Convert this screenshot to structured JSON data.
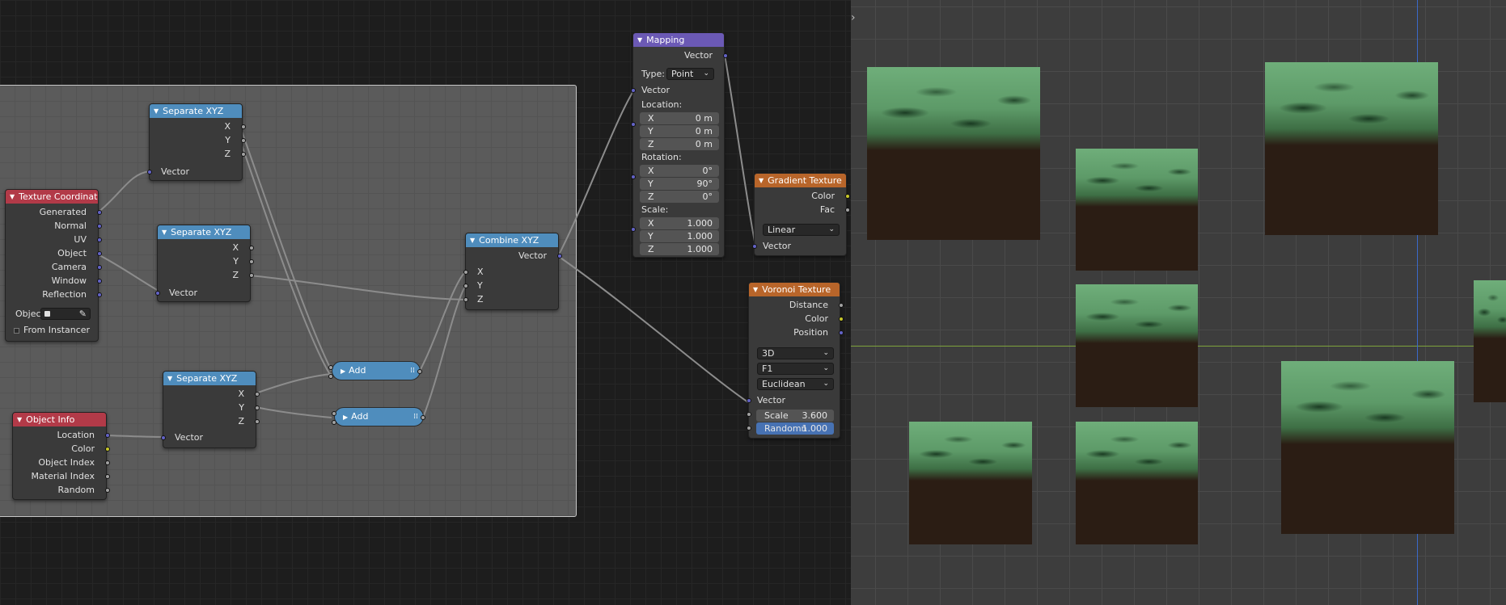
{
  "colors": {
    "vector_socket": "#6363c7",
    "float_socket": "#a1a1a1",
    "color_socket": "#c7c729",
    "input_header": "#b23a48",
    "converter_header": "#4f8dbd",
    "vector_header": "#6b59b5",
    "texture_header": "#b8652a"
  },
  "texcoord": {
    "title": "Texture Coordinate",
    "outputs": [
      "Generated",
      "Normal",
      "UV",
      "Object",
      "Camera",
      "Window",
      "Reflection"
    ],
    "object_label": "Objec",
    "from_instancer": "From Instancer",
    "eyedropper_icon": "eyedropper-icon"
  },
  "objinfo": {
    "title": "Object Info",
    "outputs": [
      "Location",
      "Color",
      "Object Index",
      "Material Index",
      "Random"
    ]
  },
  "sepxyz": {
    "title": "Separate XYZ",
    "outputs": [
      "X",
      "Y",
      "Z"
    ],
    "input": "Vector"
  },
  "add": {
    "label": "Add"
  },
  "combine": {
    "title": "Combine XYZ",
    "output": "Vector",
    "inputs": [
      "X",
      "Y",
      "Z"
    ]
  },
  "mapping": {
    "title": "Mapping",
    "output": "Vector",
    "type_label": "Type:",
    "type_value": "Point",
    "input": "Vector",
    "location_label": "Location:",
    "rotation_label": "Rotation:",
    "scale_label": "Scale:",
    "location": [
      {
        "k": "X",
        "v": "0 m"
      },
      {
        "k": "Y",
        "v": "0 m"
      },
      {
        "k": "Z",
        "v": "0 m"
      }
    ],
    "rotation": [
      {
        "k": "X",
        "v": "0°"
      },
      {
        "k": "Y",
        "v": "90°"
      },
      {
        "k": "Z",
        "v": "0°"
      }
    ],
    "scale": [
      {
        "k": "X",
        "v": "1.000"
      },
      {
        "k": "Y",
        "v": "1.000"
      },
      {
        "k": "Z",
        "v": "1.000"
      }
    ]
  },
  "gradient": {
    "title": "Gradient Texture",
    "outputs": [
      "Color",
      "Fac"
    ],
    "type": "Linear",
    "input": "Vector"
  },
  "voronoi": {
    "title": "Voronoi Texture",
    "outputs": [
      "Distance",
      "Color",
      "Position"
    ],
    "dims": "3D",
    "feature": "F1",
    "metric": "Euclidean",
    "input": "Vector",
    "scale_label": "Scale",
    "scale_value": "3.600",
    "random_label": "Randomn",
    "random_value": "1.000"
  },
  "viewport": {
    "toggle_icon": "chevron-right-icon"
  }
}
